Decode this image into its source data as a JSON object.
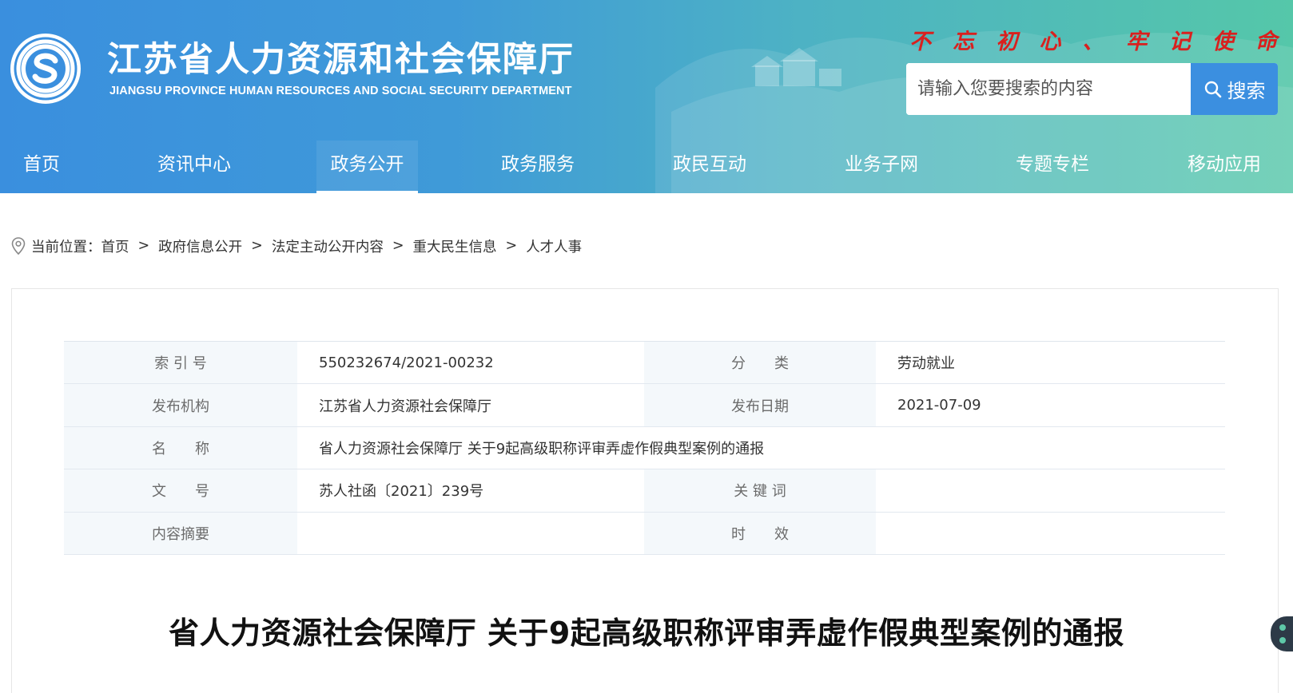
{
  "header": {
    "title": "江苏省人力资源和社会保障厅",
    "subtitle": "JIANGSU PROVINCE HUMAN RESOURCES AND SOCIAL SECURITY DEPARTMENT",
    "logo_ring_text": "江苏省人力资源和社会保障厅",
    "slogan_chars": [
      "不",
      "忘",
      "初",
      "心",
      "、",
      "牢",
      "记",
      "使",
      "命"
    ],
    "colors": {
      "header_left": "#3a8fde",
      "header_right": "#55c7a9",
      "slogan": "#d9201e",
      "search_button": "#3b8fe0"
    }
  },
  "search": {
    "placeholder": "请输入您要搜索的内容",
    "button_label": "搜索",
    "icon": "search-icon"
  },
  "nav": {
    "items": [
      {
        "label": "首页",
        "active": false
      },
      {
        "label": "资讯中心",
        "active": false
      },
      {
        "label": "政务公开",
        "active": true
      },
      {
        "label": "政务服务",
        "active": false
      },
      {
        "label": "政民互动",
        "active": false
      },
      {
        "label": "业务子网",
        "active": false
      },
      {
        "label": "专题专栏",
        "active": false
      },
      {
        "label": "移动应用",
        "active": false
      }
    ]
  },
  "breadcrumb": {
    "prefix": "当前位置：",
    "separator": ">",
    "items": [
      "首页",
      "政府信息公开",
      "法定主动公开内容",
      "重大民生信息",
      "人才人事"
    ]
  },
  "meta": {
    "index_label": "索 引 号",
    "index_value": "550232674/2021-00232",
    "category_label": "分　　类",
    "category_value": "劳动就业",
    "publisher_label": "发布机构",
    "publisher_value": "江苏省人力资源社会保障厅",
    "date_label": "发布日期",
    "date_value": "2021-07-09",
    "name_label": "名　　称",
    "name_value": "省人力资源社会保障厅 关于9起高级职称评审弄虚作假典型案例的通报",
    "doc_no_label": "文　　号",
    "doc_no_value": "苏人社函〔2021〕239号",
    "keywords_label": "关 键 词",
    "keywords_value": "",
    "summary_label": "内容摘要",
    "summary_value": "",
    "validity_label": "时　　效",
    "validity_value": ""
  },
  "article": {
    "title": "省人力资源社会保障厅 关于9起高级职称评审弄虚作假典型案例的通报"
  }
}
